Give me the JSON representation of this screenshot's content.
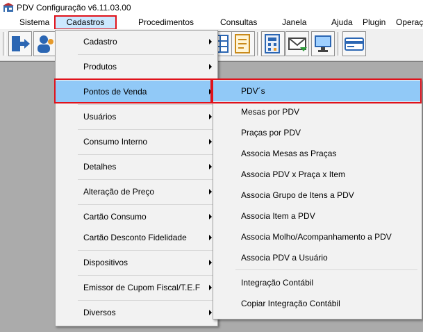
{
  "window": {
    "title": "PDV Configuração v6.11.03.00"
  },
  "menubar": {
    "items": [
      "Sistema",
      "Cadastros",
      "Procedimentos",
      "Consultas",
      "Janela",
      "Ajuda",
      "Plugin",
      "Operaç"
    ]
  },
  "toolbar": {
    "buttons": [
      "exit-icon",
      "users-icon",
      "table-icon",
      "grid-icon",
      "calculator-icon",
      "report-icon",
      "email-icon",
      "monitor-icon",
      "card-icon"
    ]
  },
  "cadastros_menu": {
    "items": [
      "Cadastro",
      "Produtos",
      "Pontos de Venda",
      "Usuários",
      "Consumo Interno",
      "Detalhes",
      "Alteração de Preço",
      "Cartão Consumo",
      "Cartão Desconto Fidelidade",
      "Dispositivos",
      "Emissor de Cupom Fiscal/T.E.F",
      "Diversos"
    ]
  },
  "pontos_submenu": {
    "items": [
      "PDV´s",
      "Mesas por PDV",
      "Praças por PDV",
      "Associa Mesas as Praças",
      "Associa PDV x Praça  x Item",
      "Associa Grupo de Itens a PDV",
      "Associa Item a PDV",
      "Associa Molho/Acompanhamento a PDV",
      "Associa PDV a Usuário",
      "Integração Contábil",
      "Copiar Integração Contábil"
    ]
  },
  "colors": {
    "highlight": "#91c9f7",
    "annotation": "#e0121b",
    "menu_bg": "#f2f2f2"
  }
}
